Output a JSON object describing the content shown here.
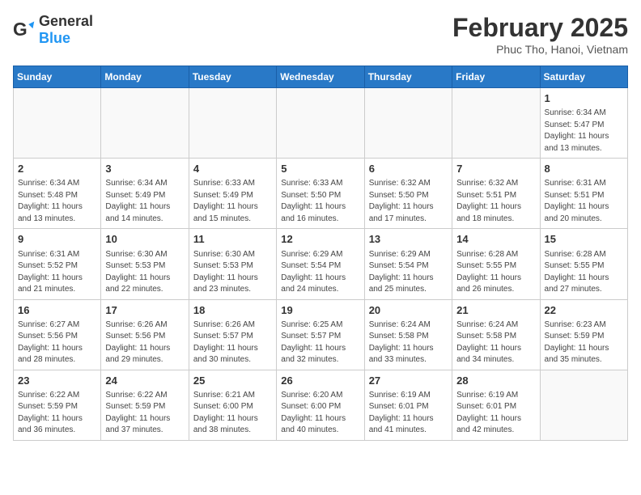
{
  "logo": {
    "general": "General",
    "blue": "Blue"
  },
  "header": {
    "title": "February 2025",
    "subtitle": "Phuc Tho, Hanoi, Vietnam"
  },
  "days_of_week": [
    "Sunday",
    "Monday",
    "Tuesday",
    "Wednesday",
    "Thursday",
    "Friday",
    "Saturday"
  ],
  "weeks": [
    [
      {
        "num": "",
        "info": ""
      },
      {
        "num": "",
        "info": ""
      },
      {
        "num": "",
        "info": ""
      },
      {
        "num": "",
        "info": ""
      },
      {
        "num": "",
        "info": ""
      },
      {
        "num": "",
        "info": ""
      },
      {
        "num": "1",
        "info": "Sunrise: 6:34 AM\nSunset: 5:47 PM\nDaylight: 11 hours and 13 minutes."
      }
    ],
    [
      {
        "num": "2",
        "info": "Sunrise: 6:34 AM\nSunset: 5:48 PM\nDaylight: 11 hours and 13 minutes."
      },
      {
        "num": "3",
        "info": "Sunrise: 6:34 AM\nSunset: 5:49 PM\nDaylight: 11 hours and 14 minutes."
      },
      {
        "num": "4",
        "info": "Sunrise: 6:33 AM\nSunset: 5:49 PM\nDaylight: 11 hours and 15 minutes."
      },
      {
        "num": "5",
        "info": "Sunrise: 6:33 AM\nSunset: 5:50 PM\nDaylight: 11 hours and 16 minutes."
      },
      {
        "num": "6",
        "info": "Sunrise: 6:32 AM\nSunset: 5:50 PM\nDaylight: 11 hours and 17 minutes."
      },
      {
        "num": "7",
        "info": "Sunrise: 6:32 AM\nSunset: 5:51 PM\nDaylight: 11 hours and 18 minutes."
      },
      {
        "num": "8",
        "info": "Sunrise: 6:31 AM\nSunset: 5:51 PM\nDaylight: 11 hours and 20 minutes."
      }
    ],
    [
      {
        "num": "9",
        "info": "Sunrise: 6:31 AM\nSunset: 5:52 PM\nDaylight: 11 hours and 21 minutes."
      },
      {
        "num": "10",
        "info": "Sunrise: 6:30 AM\nSunset: 5:53 PM\nDaylight: 11 hours and 22 minutes."
      },
      {
        "num": "11",
        "info": "Sunrise: 6:30 AM\nSunset: 5:53 PM\nDaylight: 11 hours and 23 minutes."
      },
      {
        "num": "12",
        "info": "Sunrise: 6:29 AM\nSunset: 5:54 PM\nDaylight: 11 hours and 24 minutes."
      },
      {
        "num": "13",
        "info": "Sunrise: 6:29 AM\nSunset: 5:54 PM\nDaylight: 11 hours and 25 minutes."
      },
      {
        "num": "14",
        "info": "Sunrise: 6:28 AM\nSunset: 5:55 PM\nDaylight: 11 hours and 26 minutes."
      },
      {
        "num": "15",
        "info": "Sunrise: 6:28 AM\nSunset: 5:55 PM\nDaylight: 11 hours and 27 minutes."
      }
    ],
    [
      {
        "num": "16",
        "info": "Sunrise: 6:27 AM\nSunset: 5:56 PM\nDaylight: 11 hours and 28 minutes."
      },
      {
        "num": "17",
        "info": "Sunrise: 6:26 AM\nSunset: 5:56 PM\nDaylight: 11 hours and 29 minutes."
      },
      {
        "num": "18",
        "info": "Sunrise: 6:26 AM\nSunset: 5:57 PM\nDaylight: 11 hours and 30 minutes."
      },
      {
        "num": "19",
        "info": "Sunrise: 6:25 AM\nSunset: 5:57 PM\nDaylight: 11 hours and 32 minutes."
      },
      {
        "num": "20",
        "info": "Sunrise: 6:24 AM\nSunset: 5:58 PM\nDaylight: 11 hours and 33 minutes."
      },
      {
        "num": "21",
        "info": "Sunrise: 6:24 AM\nSunset: 5:58 PM\nDaylight: 11 hours and 34 minutes."
      },
      {
        "num": "22",
        "info": "Sunrise: 6:23 AM\nSunset: 5:59 PM\nDaylight: 11 hours and 35 minutes."
      }
    ],
    [
      {
        "num": "23",
        "info": "Sunrise: 6:22 AM\nSunset: 5:59 PM\nDaylight: 11 hours and 36 minutes."
      },
      {
        "num": "24",
        "info": "Sunrise: 6:22 AM\nSunset: 5:59 PM\nDaylight: 11 hours and 37 minutes."
      },
      {
        "num": "25",
        "info": "Sunrise: 6:21 AM\nSunset: 6:00 PM\nDaylight: 11 hours and 38 minutes."
      },
      {
        "num": "26",
        "info": "Sunrise: 6:20 AM\nSunset: 6:00 PM\nDaylight: 11 hours and 40 minutes."
      },
      {
        "num": "27",
        "info": "Sunrise: 6:19 AM\nSunset: 6:01 PM\nDaylight: 11 hours and 41 minutes."
      },
      {
        "num": "28",
        "info": "Sunrise: 6:19 AM\nSunset: 6:01 PM\nDaylight: 11 hours and 42 minutes."
      },
      {
        "num": "",
        "info": ""
      }
    ]
  ]
}
